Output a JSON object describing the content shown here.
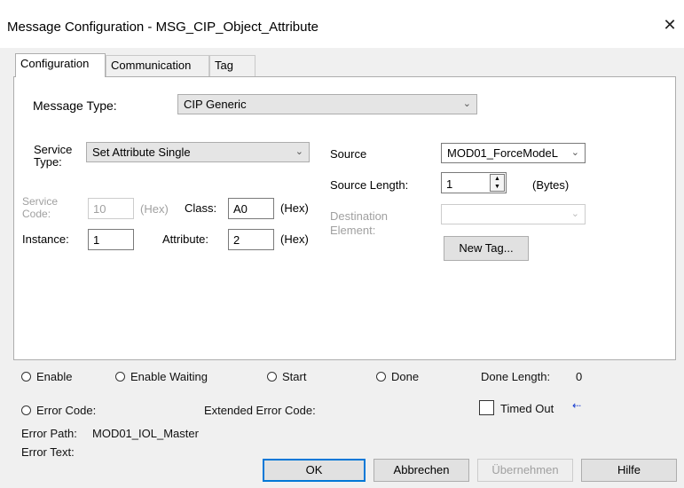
{
  "window": {
    "title": "Message Configuration - MSG_CIP_Object_Attribute"
  },
  "tabs": [
    {
      "label": "Configuration"
    },
    {
      "label": "Communication"
    },
    {
      "label": "Tag"
    }
  ],
  "config": {
    "message_type_label": "Message Type:",
    "message_type_value": "CIP Generic",
    "service_type_label_1": "Service",
    "service_type_label_2": "Type:",
    "service_type_value": "Set Attribute Single",
    "service_code_label_1": "Service",
    "service_code_label_2": "Code:",
    "service_code_value": "10",
    "hex_label": "(Hex)",
    "class_label": "Class:",
    "class_value": "A0",
    "instance_label": "Instance:",
    "instance_value": "1",
    "attribute_label": "Attribute:",
    "attribute_value": "2",
    "source_label": "Source",
    "source_value": "MOD01_ForceModeL",
    "source_length_label": "Source Length:",
    "source_length_value": "1",
    "bytes_label": "(Bytes)",
    "destination_label_1": "Destination",
    "destination_label_2": "Element:",
    "destination_value": "",
    "new_tag_label": "New Tag..."
  },
  "status": {
    "enable": "Enable",
    "enable_waiting": "Enable Waiting",
    "start": "Start",
    "done": "Done",
    "done_length_label": "Done Length:",
    "done_length_value": "0",
    "error_code": "Error Code:",
    "extended_error_code": "Extended Error Code:",
    "timed_out": "Timed Out",
    "error_path_label": "Error Path:",
    "error_path_value": "MOD01_IOL_Master",
    "error_text_label": "Error Text:"
  },
  "buttons": {
    "ok": "OK",
    "cancel": "Abbrechen",
    "apply": "Übernehmen",
    "help": "Hilfe"
  },
  "colors": {
    "accent": "#0078d7",
    "dialog_bg": "#f0f0f0",
    "disabled_text": "#a0a0a0"
  },
  "icons": {
    "close": "close-icon",
    "dropdown": "chevron-down-icon",
    "timed_out_arrow": "arrow-left-icon"
  }
}
